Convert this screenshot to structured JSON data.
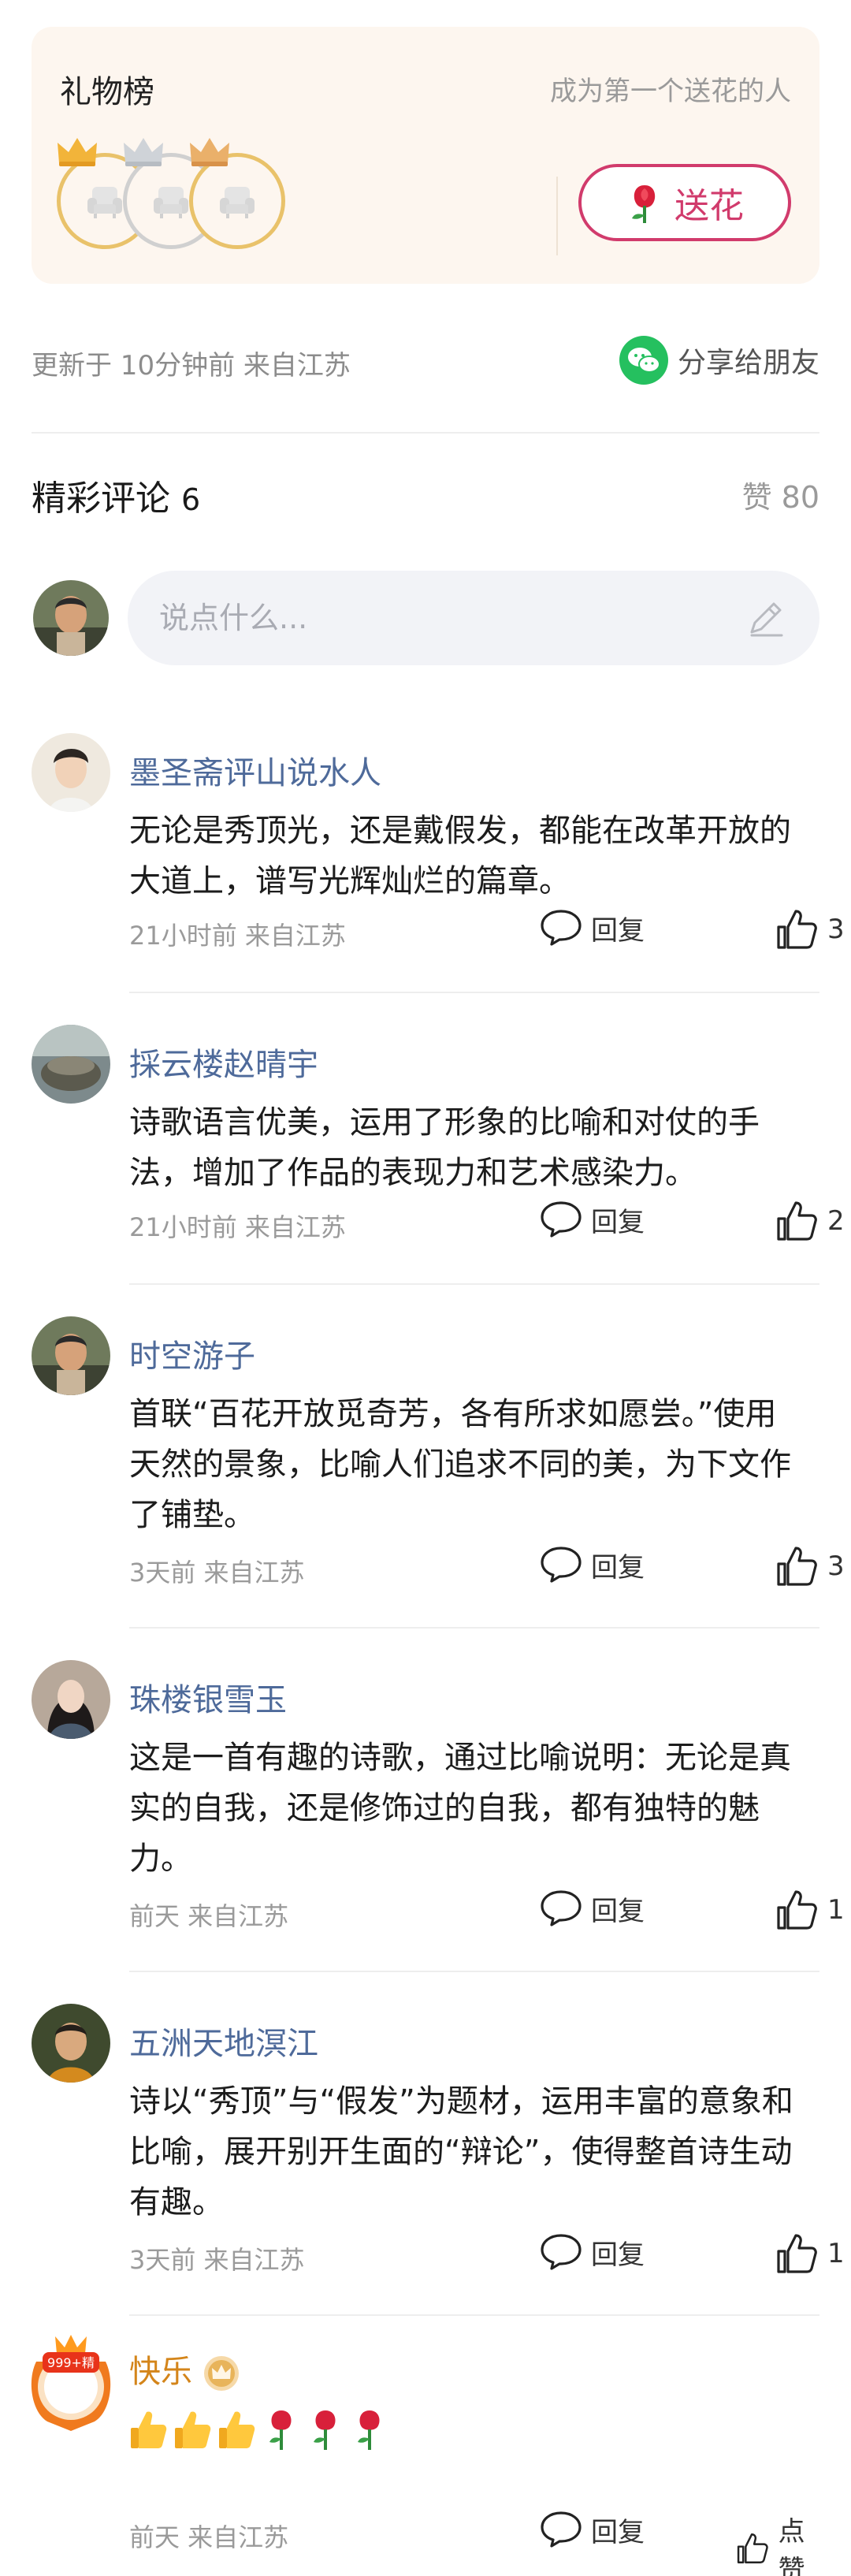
{
  "gift": {
    "title": "礼物榜",
    "hint": "成为第一个送花的人",
    "flower_label": "送花"
  },
  "meta": {
    "updated": "更新于 10分钟前   来自江苏",
    "share_label": "分享给朋友"
  },
  "comments_header": {
    "title": "精彩评论",
    "count": "6",
    "likes": "赞 80"
  },
  "input": {
    "placeholder": "说点什么..."
  },
  "comments": [
    {
      "name": "墨圣斋评山说水人",
      "body": "无论是秀顶光，还是戴假发，都能在改革开放的大道上，谱写光辉灿烂的篇章。",
      "time": "21小时前   来自江苏",
      "reply": "回复",
      "likes": "3"
    },
    {
      "name": "採云楼赵晴宇",
      "body": "诗歌语言优美，运用了形象的比喻和对仗的手法，增加了作品的表现力和艺术感染力。",
      "time": "21小时前   来自江苏",
      "reply": "回复",
      "likes": "2"
    },
    {
      "name": "时空游子",
      "body": "首联“百花开放觅奇芳，各有所求如愿尝。”使用天然的景象，比喻人们追求不同的美，为下文作了铺垫。",
      "time": "3天前   来自江苏",
      "reply": "回复",
      "likes": "3"
    },
    {
      "name": "珠楼银雪玉",
      "body": "这是一首有趣的诗歌，通过比喻说明：无论是真实的自我，还是修饰过的自我，都有独特的魅力。",
      "time": "前天   来自江苏",
      "reply": "回复",
      "likes": "1"
    },
    {
      "name": "五洲天地溟江",
      "body": "诗以“秀顶”与“假发”为题材，运用丰富的意象和比喻，展开别开生面的“辩论”，使得整首诗生动有趣。",
      "time": "3天前   来自江苏",
      "reply": "回复",
      "likes": "1"
    },
    {
      "name": "快乐",
      "badge": "999+精",
      "time": "前天   来自江苏",
      "reply": "回复",
      "likes": "点赞"
    }
  ],
  "colors": {
    "accent": "#d13b6c",
    "name": "#4e6a9a",
    "vip": "#d4851a",
    "wechat": "#25c05f",
    "card": "#fdf6ef"
  },
  "icons": [
    "crown-gold-icon",
    "crown-silver-icon",
    "crown-bronze-icon",
    "seat-icon",
    "rose-icon",
    "wechat-icon",
    "pencil-icon",
    "comment-bubble-icon",
    "thumbs-up-icon"
  ]
}
